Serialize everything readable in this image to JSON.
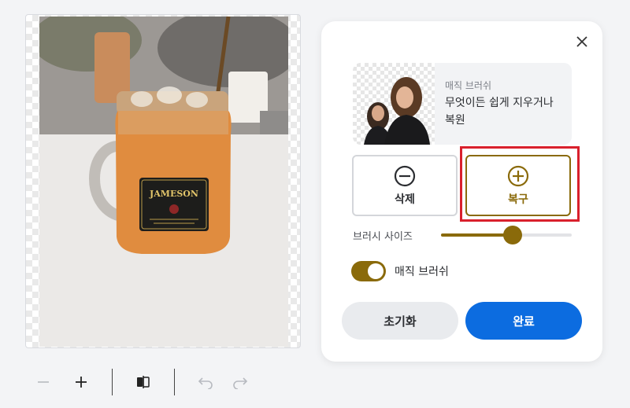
{
  "editor": {
    "canvas": {
      "image_semantic": "jameson-jar-photo"
    },
    "toolbar": {
      "zoom_out_icon": "minus-icon",
      "zoom_in_icon": "plus-icon",
      "compare_icon": "compare-icon",
      "undo_icon": "undo-icon",
      "redo_icon": "redo-icon"
    }
  },
  "panel": {
    "close_icon": "close-icon",
    "feature": {
      "title": "매직 브러쉬",
      "description": "무엇이든 쉽게 지우거나 복원"
    },
    "modes": [
      {
        "label": "삭제",
        "icon": "minus-circle-icon",
        "selected": false
      },
      {
        "label": "복구",
        "icon": "plus-circle-icon",
        "selected": true
      }
    ],
    "brush_size": {
      "label": "브러시 사이즈",
      "value_fraction": 0.55
    },
    "magic_brush_toggle": {
      "label": "매직 브러쉬",
      "on": true
    },
    "reset_label": "초기화",
    "done_label": "완료"
  },
  "colors": {
    "accent": "#8a6a0a",
    "primary": "#0c6ce0",
    "highlight": "#d9202c"
  }
}
